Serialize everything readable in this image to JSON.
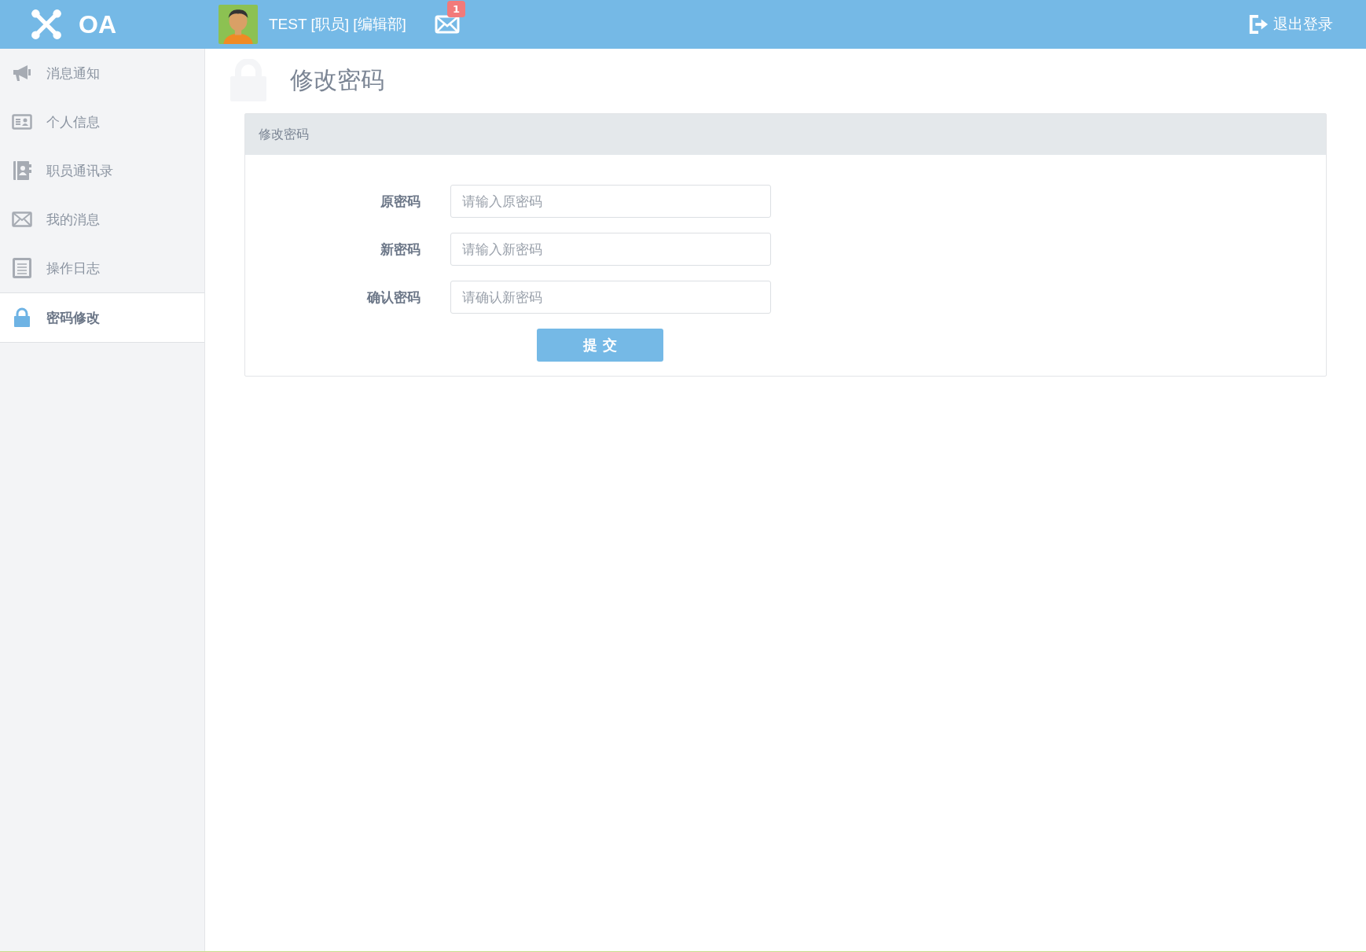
{
  "header": {
    "logo": "OA",
    "user": "TEST [职员] [编辑部]",
    "mail_badge": "1",
    "logout": "退出登录"
  },
  "sidebar": {
    "items": [
      {
        "label": "消息通知",
        "kind": "megaphone",
        "selected": false
      },
      {
        "label": "个人信息",
        "kind": "card",
        "selected": false
      },
      {
        "label": "职员通讯录",
        "kind": "book",
        "selected": false
      },
      {
        "label": "我的消息",
        "kind": "mail",
        "selected": false
      },
      {
        "label": "操作日志",
        "kind": "log",
        "selected": false
      },
      {
        "label": "密码修改",
        "kind": "lock",
        "selected": true
      }
    ]
  },
  "page_title": "修改密码",
  "panel": {
    "title": "修改密码",
    "fields": [
      {
        "label": "原密码",
        "placeholder": "请输入原密码"
      },
      {
        "label": "新密码",
        "placeholder": "请输入新密码"
      },
      {
        "label": "确认密码",
        "placeholder": "请确认新密码"
      }
    ],
    "submit": "提 交"
  }
}
